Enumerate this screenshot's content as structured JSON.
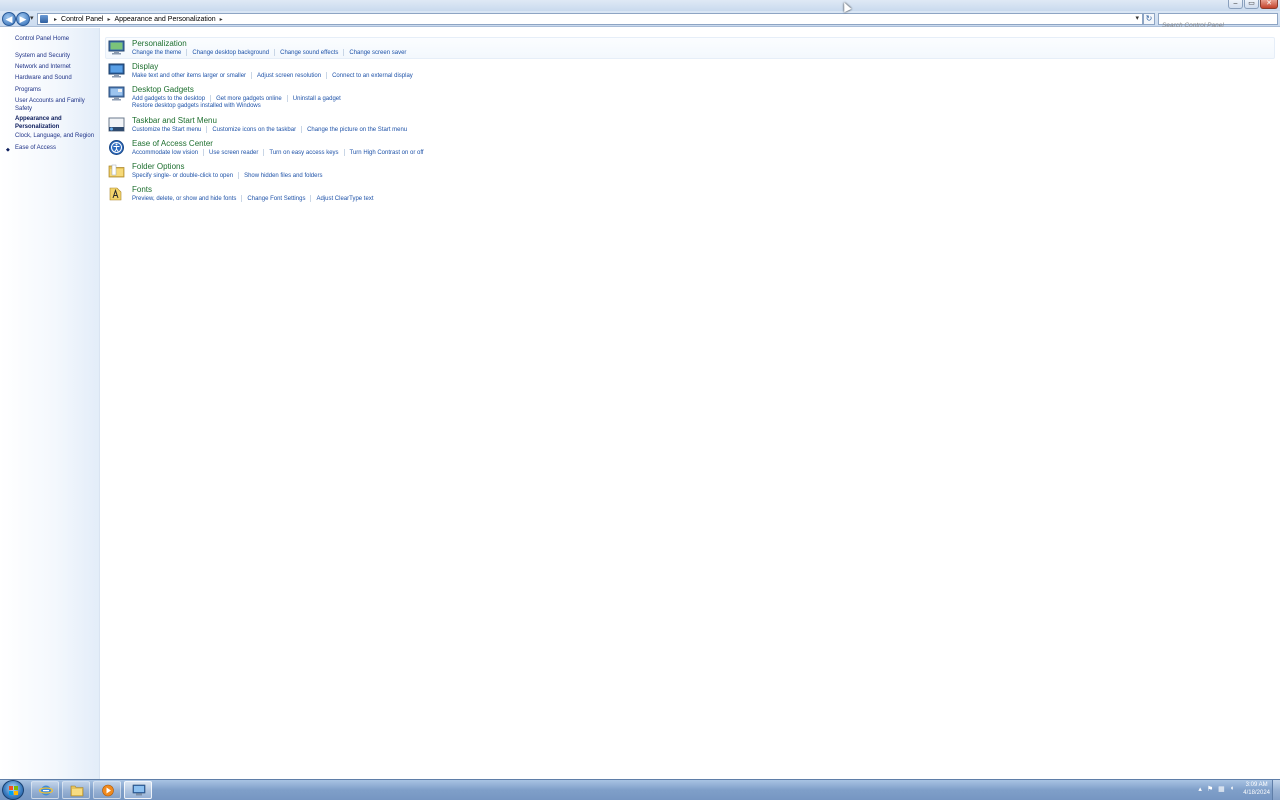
{
  "window": {
    "controls": {
      "minimize": "–",
      "maximize": "▭",
      "close": "✕"
    }
  },
  "navigation": {
    "back_icon": "back-arrow-icon",
    "forward_icon": "forward-arrow-icon",
    "breadcrumb": [
      "Control Panel",
      "Appearance and Personalization"
    ],
    "search_placeholder": "Search Control Panel"
  },
  "sidebar": {
    "home": "Control Panel Home",
    "items": [
      {
        "label": "System and Security"
      },
      {
        "label": "Network and Internet"
      },
      {
        "label": "Hardware and Sound"
      },
      {
        "label": "Programs"
      },
      {
        "label": "User Accounts and Family Safety"
      },
      {
        "label": "Appearance and Personalization",
        "current": true
      },
      {
        "label": "Clock, Language, and Region"
      },
      {
        "label": "Ease of Access"
      }
    ]
  },
  "categories": [
    {
      "title": "Personalization",
      "icon": "personalization-icon",
      "links": [
        "Change the theme",
        "Change desktop background",
        "Change sound effects",
        "Change screen saver"
      ]
    },
    {
      "title": "Display",
      "icon": "display-icon",
      "links": [
        "Make text and other items larger or smaller",
        "Adjust screen resolution",
        "Connect to an external display"
      ]
    },
    {
      "title": "Desktop Gadgets",
      "icon": "desktop-gadgets-icon",
      "links": [
        "Add gadgets to the desktop",
        "Get more gadgets online",
        "Uninstall a gadget"
      ],
      "links2": [
        "Restore desktop gadgets installed with Windows"
      ]
    },
    {
      "title": "Taskbar and Start Menu",
      "icon": "taskbar-icon",
      "links": [
        "Customize the Start menu",
        "Customize icons on the taskbar",
        "Change the picture on the Start menu"
      ]
    },
    {
      "title": "Ease of Access Center",
      "icon": "ease-of-access-icon",
      "links": [
        "Accommodate low vision",
        "Use screen reader",
        "Turn on easy access keys",
        "Turn High Contrast on or off"
      ]
    },
    {
      "title": "Folder Options",
      "icon": "folder-options-icon",
      "links": [
        "Specify single- or double-click to open",
        "Show hidden files and folders"
      ]
    },
    {
      "title": "Fonts",
      "icon": "fonts-icon",
      "links": [
        "Preview, delete, or show and hide fonts",
        "Change Font Settings",
        "Adjust ClearType text"
      ]
    }
  ],
  "taskbar": {
    "pinned": [
      "internet-explorer-icon",
      "windows-explorer-icon",
      "media-player-icon",
      "control-panel-icon"
    ],
    "clock_time": "3:09 AM",
    "clock_date": "4/18/2024"
  }
}
